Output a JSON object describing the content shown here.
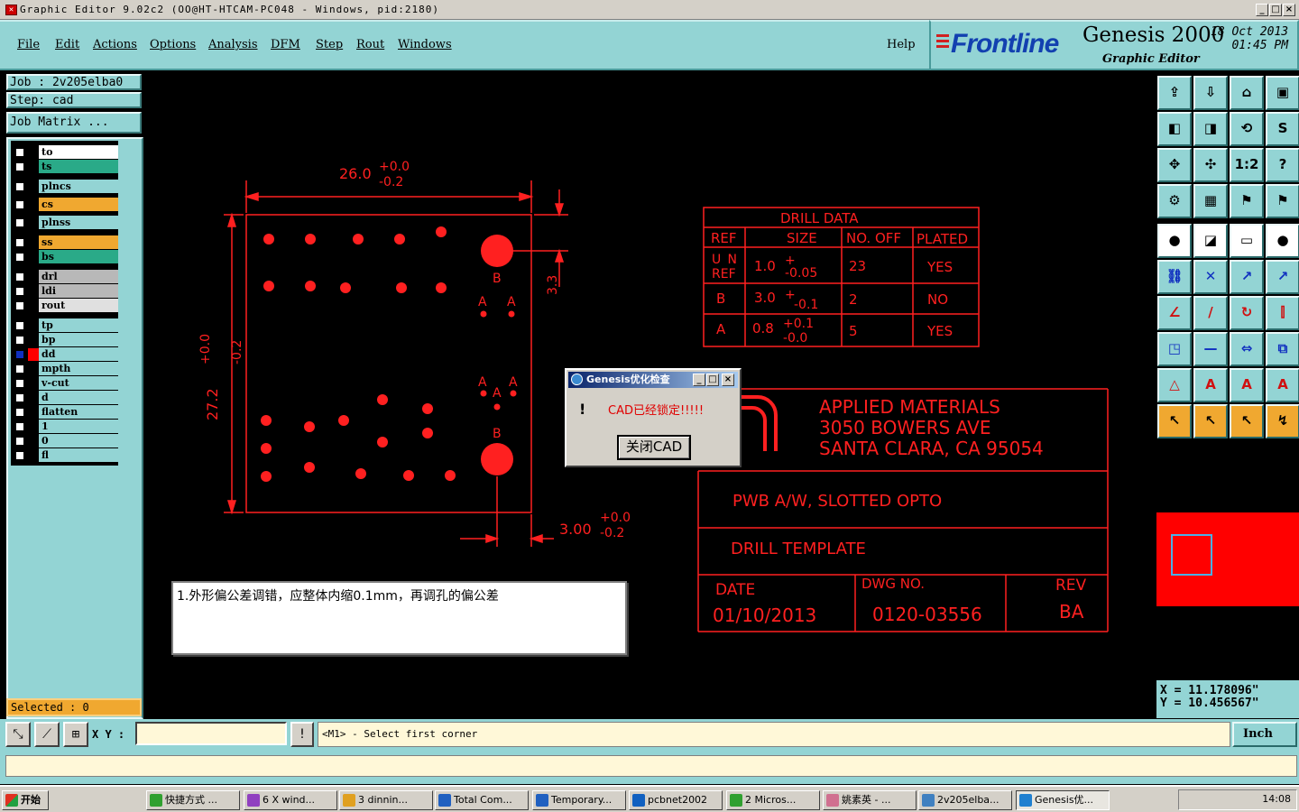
{
  "window": {
    "title": "Graphic Editor 9.02c2  (OO@HT-HTCAM-PC048 - Windows, pid:2180)"
  },
  "menu": [
    "File",
    "Edit",
    "Actions",
    "Options",
    "Analysis",
    "DFM",
    "Step",
    "Rout",
    "Windows"
  ],
  "help_label": "Help",
  "brand": {
    "logo": "Frontline",
    "product": "Genesis 2000",
    "subtitle": "Graphic Editor",
    "date": "18 Oct 2013",
    "time": "01:45 PM"
  },
  "job": {
    "job_label": "Job : 2v205elba0",
    "step_label": "Step: cad",
    "matrix_label": "Job Matrix ..."
  },
  "layers": [
    {
      "name": "to",
      "color": "#ffffff"
    },
    {
      "name": "ts",
      "color": "#2aaa88"
    },
    {
      "name": "plncs",
      "color": "#93d4d4"
    },
    {
      "name": "cs",
      "color": "#f0a830"
    },
    {
      "name": "plnss",
      "color": "#93d4d4"
    },
    {
      "name": "ss",
      "color": "#f0a830"
    },
    {
      "name": "bs",
      "color": "#2aaa88"
    },
    {
      "name": "drl",
      "color": "#b8b8b8"
    },
    {
      "name": "ldi",
      "color": "#b8b8b8"
    },
    {
      "name": "rout",
      "color": "#e0e0e0"
    },
    {
      "name": "tp",
      "color": "#93d4d4"
    },
    {
      "name": "bp",
      "color": "#93d4d4"
    },
    {
      "name": "dd",
      "color": "#93d4d4"
    },
    {
      "name": "mpth",
      "color": "#93d4d4"
    },
    {
      "name": "v-cut",
      "color": "#93d4d4"
    },
    {
      "name": "d",
      "color": "#93d4d4"
    },
    {
      "name": "flatten",
      "color": "#93d4d4"
    },
    {
      "name": "1",
      "color": "#93d4d4"
    },
    {
      "name": "0",
      "color": "#93d4d4"
    },
    {
      "name": "fl",
      "color": "#93d4d4"
    }
  ],
  "selected_label": "Selected : 0",
  "coords": {
    "x": "X = 11.178096\"",
    "y": "Y = 10.456567\""
  },
  "command": {
    "xy_label": "X Y :",
    "prompt": "<M1> - Select first corner",
    "unit": "Inch"
  },
  "dialog": {
    "title": "Genesis优化检查",
    "message": "CAD已经锁定!!!!!",
    "button": "关闭CAD"
  },
  "note": "1.外形偏公差调错，应整体内缩0.1mm，再调孔的偏公差",
  "drawing": {
    "dim_width": "26.0",
    "dim_width_tol_plus": "+0.0",
    "dim_width_tol_minus": "-0.2",
    "dim_height": "27.2",
    "dim_height_tol_plus": "+0.0",
    "dim_height_tol_minus": "-0.2",
    "dim_33": "3.3",
    "dim_300": "3.00",
    "dim_300_tol_plus": "+0.0",
    "dim_300_tol_minus": "-0.2",
    "label_a": "A",
    "label_b": "B",
    "drill_title": "DRILL DATA",
    "drill_headers": [
      "REF",
      "SIZE",
      "NO. OFF",
      "PLATED"
    ],
    "drill_rows": [
      {
        "ref": "UN REF",
        "size": "1.0",
        "tol_p": "+",
        "tol_m": "-0.05",
        "no": "23",
        "plated": "YES"
      },
      {
        "ref": "B",
        "size": "3.0",
        "tol_p": "+",
        "tol_m": "-0.1",
        "no": "2",
        "plated": "NO"
      },
      {
        "ref": "A",
        "size": "0.8",
        "tol_p": "+0.1",
        "tol_m": "-0.0",
        "no": "5",
        "plated": "YES"
      }
    ],
    "company_1": "APPLIED MATERIALS",
    "company_2": "3050 BOWERS AVE",
    "company_3": "SANTA CLARA, CA 95054",
    "part_title": "PWB A/W, SLOTTED OPTO",
    "doc_title": "DRILL TEMPLATE",
    "date_label": "DATE",
    "date_value": "01/10/2013",
    "dwg_label": "DWG NO.",
    "dwg_value": "0120-03556",
    "rev_label": "REV",
    "rev_value": "BA"
  },
  "taskbar": {
    "start": "开始",
    "tasks": [
      "快捷方式 ...",
      "6 X wind...",
      "3 dinnin...",
      "Total Com...",
      "Temporary...",
      "pcbnet2002",
      "2 Micros...",
      "姚素英 - ...",
      "2v205elba...",
      "Genesis优..."
    ],
    "clock": "14:08"
  },
  "colors": {
    "panel": "#93d4d4",
    "drawing": "#ff0000",
    "accent": "#f0a830"
  }
}
